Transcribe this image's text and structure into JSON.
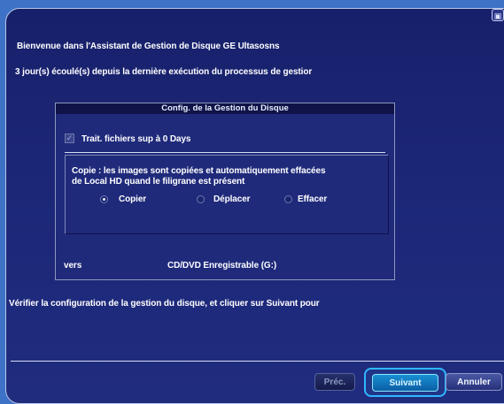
{
  "header": {
    "welcome_text": "Bienvenue dans l'Assistant de Gestion de Disque  GE Ultasosns",
    "elapsed_text": "3 jour(s) écoulé(s) depuis la dernière exécution  du processus de gestior"
  },
  "config_panel": {
    "title": "Config. de la Gestion du Disque",
    "checkbox": {
      "label": "Trait. fichiers sup à 0 Days",
      "checked": true
    },
    "copy_description": {
      "line1": "Copie : les images sont copiées et automatiquement effacées",
      "line2": "de Local HD quand le filigrane est présent"
    },
    "radio_options": [
      {
        "label": "Copier",
        "selected": true
      },
      {
        "label": "Déplacer",
        "selected": false
      },
      {
        "label": "Effacer",
        "selected": false
      }
    ],
    "destination": {
      "label": "vers",
      "value": "CD/DVD Enregistrable (G:)"
    }
  },
  "footer_instruction": "Vérifier la configuration de la gestion du disque, et cliquer sur Suivant pour",
  "buttons": {
    "prev_label": "Préc.",
    "next_label": "Suivant",
    "cancel_label": "Annuler"
  },
  "colors": {
    "background_outer": "#3d72c6",
    "window_background": "#1c2778",
    "highlight": "#2fb7ff"
  },
  "icons": {
    "corner_icon": "window-corner-icon"
  }
}
